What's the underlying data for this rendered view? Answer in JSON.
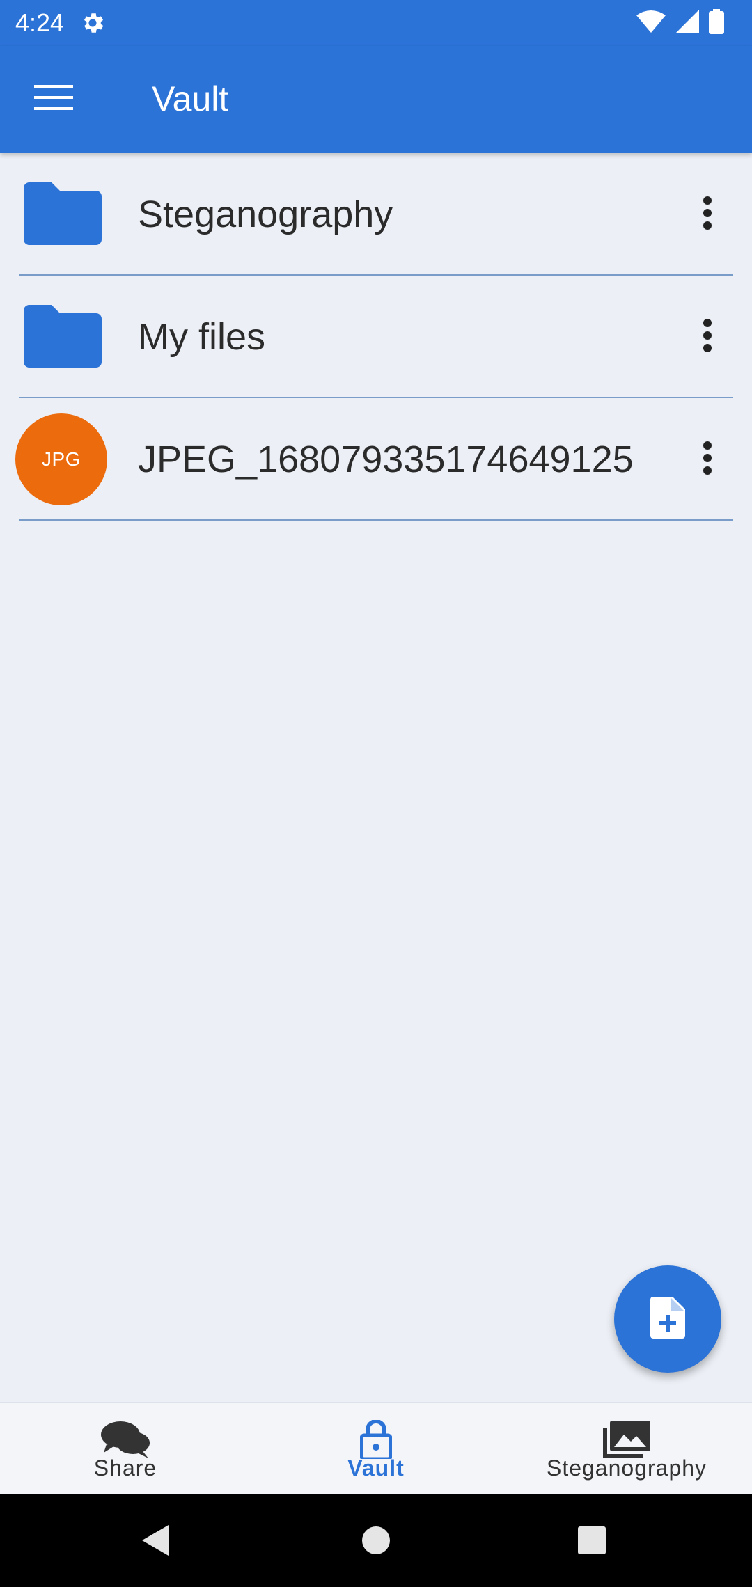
{
  "status_bar": {
    "time": "4:24",
    "icons": [
      "gear-icon",
      "wifi-icon",
      "cellular-signal-icon",
      "battery-icon"
    ]
  },
  "app_bar": {
    "title": "Vault",
    "menu_icon": "hamburger-menu-icon"
  },
  "files": [
    {
      "label": "Steganography",
      "type": "folder",
      "icon": "folder-icon"
    },
    {
      "label": "My files",
      "type": "folder",
      "icon": "folder-icon"
    },
    {
      "label": "JPEG_1680793351746491​25",
      "type": "file",
      "badge": "JPG"
    }
  ],
  "fab": {
    "icon": "add-file-icon"
  },
  "bottom_nav": {
    "items": [
      {
        "label": "Share",
        "icon": "chat-bubbles-icon",
        "active": false
      },
      {
        "label": "Vault",
        "icon": "lock-icon",
        "active": true
      },
      {
        "label": "Steganography",
        "icon": "photos-icon",
        "active": false
      }
    ]
  },
  "colors": {
    "primary": "#2c73d8",
    "background": "#ecf0f6",
    "jpg_badge": "#ec6b0d",
    "divider": "#7a9cc9"
  }
}
